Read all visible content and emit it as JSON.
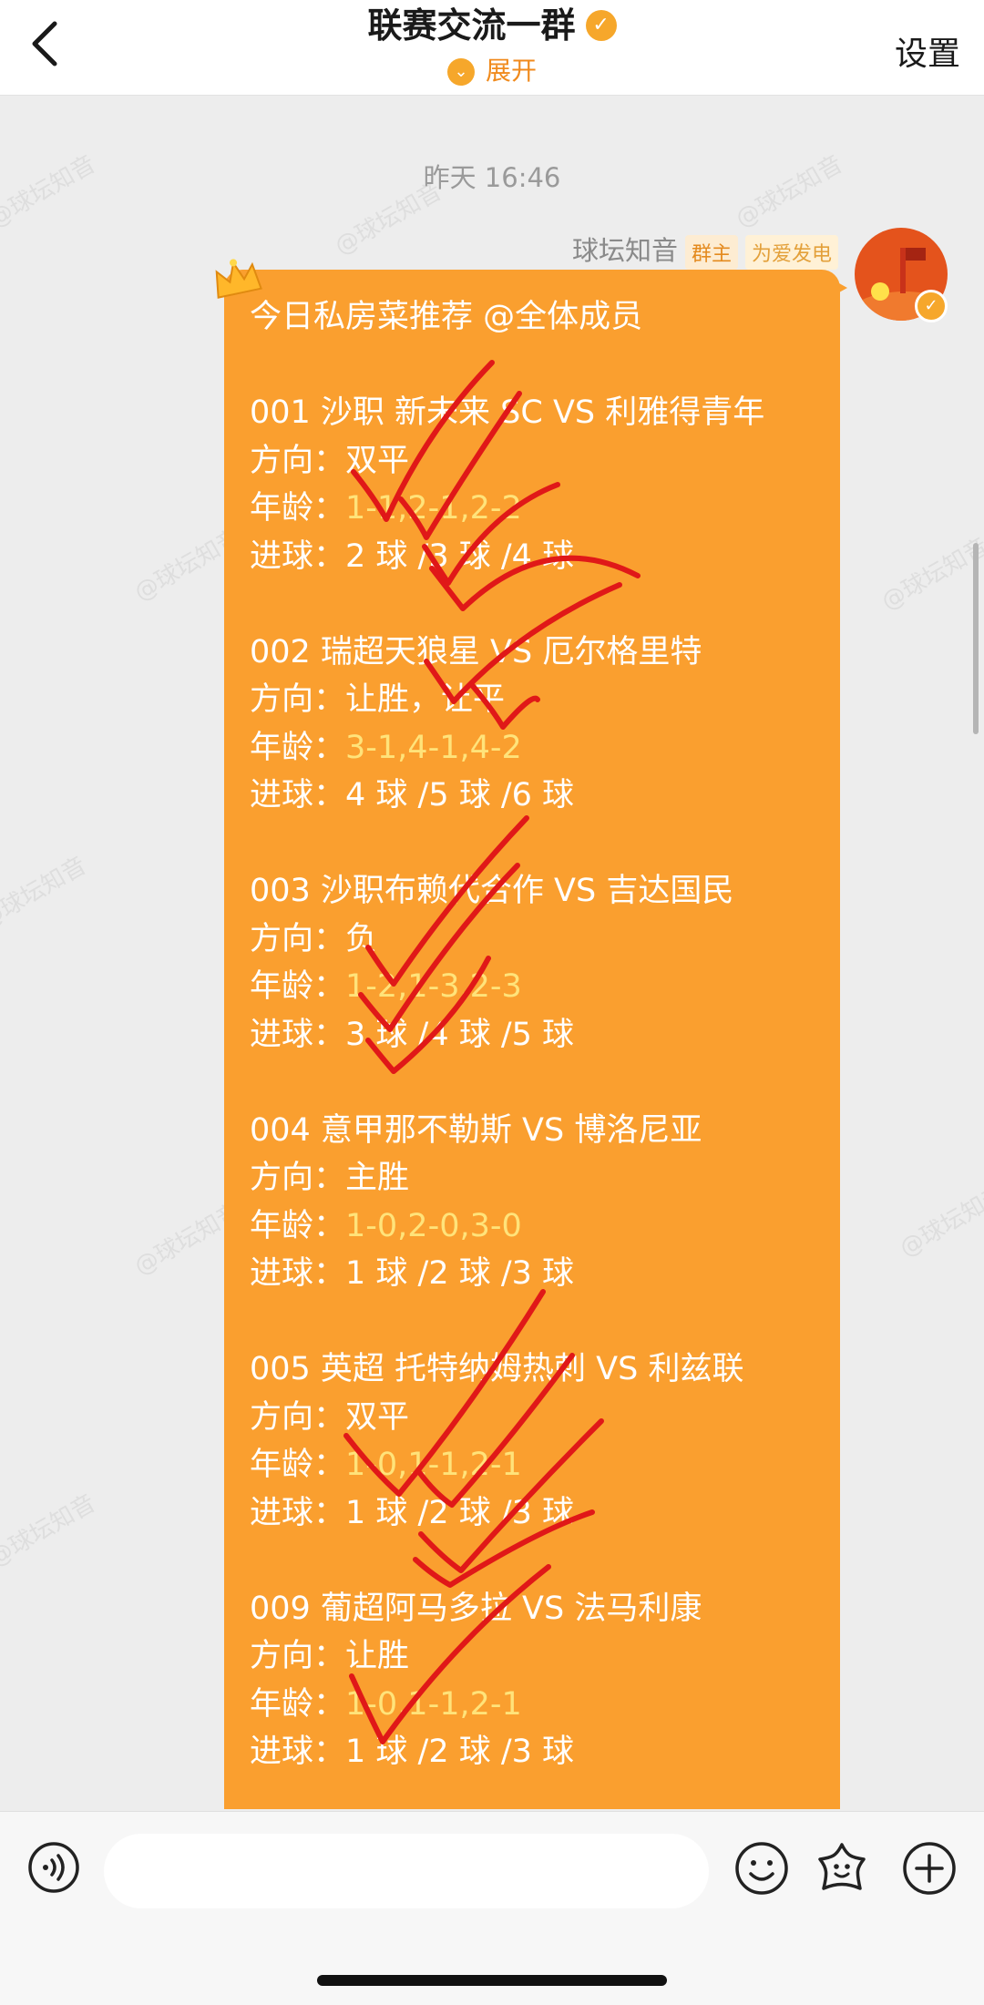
{
  "header": {
    "title": "联赛交流一群",
    "expand_label": "展开",
    "settings_label": "设置"
  },
  "watermark_text": "@球坛知音",
  "chat": {
    "timestamp": "昨天 16:46",
    "sender": {
      "name": "球坛知音",
      "role_tag": "群主",
      "power_tag": "为爱发电"
    },
    "message": {
      "intro": "今日私房菜推荐 @全体成员",
      "labels": {
        "direction": "方向：",
        "age": "年龄：",
        "goals": "进球："
      },
      "matches": [
        {
          "title": "001 沙职 新未来 SC VS 利雅得青年",
          "direction": "双平",
          "age": "1-1,2-1,2-2",
          "goals": "2 球 /3 球 /4 球"
        },
        {
          "title": "002 瑞超天狼星 VS 厄尔格里特",
          "direction": "让胜，让平",
          "age": "3-1,4-1,4-2",
          "goals": "4 球 /5 球 /6 球"
        },
        {
          "title": "003 沙职布赖代合作 VS 吉达国民",
          "direction": "负",
          "age": "1-2,1-3,2-3",
          "goals": "3 球 /4 球 /5 球"
        },
        {
          "title": "004 意甲那不勒斯 VS 博洛尼亚",
          "direction": "主胜",
          "age": "1-0,2-0,3-0",
          "goals": "1 球 /2 球 /3 球"
        },
        {
          "title": "005 英超 托特纳姆热刺 VS 利兹联",
          "direction": "双平",
          "age": "1-0,1-1,2-1",
          "goals": "1 球 /2 球 /3 球"
        },
        {
          "title": "009 葡超阿马多拉 VS 法马利康",
          "direction": "让胜",
          "age": "1-0,1-1,2-1",
          "goals": "1 球 /2 球 /3 球"
        }
      ]
    }
  },
  "colors": {
    "bubble": "#fa9f2f",
    "age_value": "#ffe37a",
    "check_mark": "#e01818",
    "accent": "#f6a72b"
  },
  "icons": [
    "back-arrow-icon",
    "verified-icon",
    "expand-icon",
    "crown-icon",
    "voice-icon",
    "emoji-icon",
    "sticker-icon",
    "plus-icon"
  ]
}
